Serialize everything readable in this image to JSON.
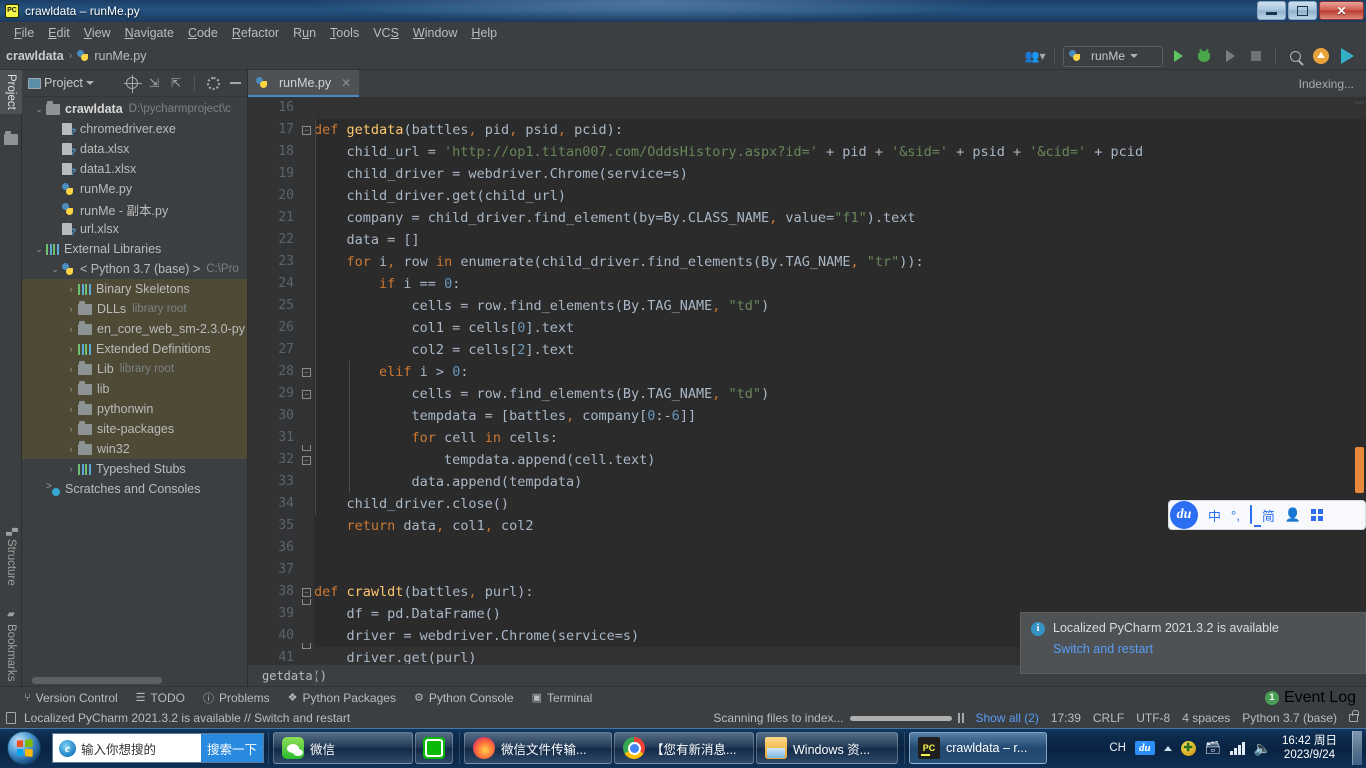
{
  "window": {
    "title": "crawldata – runMe.py",
    "app_icon": "pycharm-icon",
    "controls": {
      "minimize": "minimize-button",
      "restore": "restore-button",
      "close": "✕"
    }
  },
  "menubar": {
    "items": [
      {
        "label": "File"
      },
      {
        "label": "Edit"
      },
      {
        "label": "View"
      },
      {
        "label": "Navigate"
      },
      {
        "label": "Code"
      },
      {
        "label": "Refactor"
      },
      {
        "label": "Run"
      },
      {
        "label": "Tools"
      },
      {
        "label": "VCS"
      },
      {
        "label": "Window"
      },
      {
        "label": "Help"
      }
    ]
  },
  "navbar": {
    "breadcrumbs": [
      "crawldata",
      "runMe.py"
    ],
    "separator": "›",
    "run_config": "runMe",
    "icons": [
      "user-settings-icon",
      "run-icon",
      "debug-icon",
      "run-with-coverage-icon",
      "stop-icon",
      "search-everywhere-icon",
      "update-project-icon",
      "play-alt-icon"
    ]
  },
  "left_tool_strip": {
    "top": [
      {
        "label": "Project",
        "active": true
      }
    ],
    "bottom": [
      {
        "label": "Structure"
      },
      {
        "label": "Bookmarks"
      }
    ]
  },
  "project_panel": {
    "title": "Project",
    "header_icons": [
      "locate-icon",
      "expand-all-icon",
      "collapse-all-icon",
      "gear-icon",
      "hide-icon"
    ],
    "tree": [
      {
        "indent": 0,
        "twist": "v",
        "icon": "folder-icon",
        "label": "crawldata",
        "bold": true,
        "sub": "D:\\pycharmproject\\c",
        "selected": false
      },
      {
        "indent": 1,
        "twist": "",
        "icon": "xlsx-icon",
        "label": "chromedriver.exe",
        "bold": false,
        "sub": "",
        "selected": false
      },
      {
        "indent": 1,
        "twist": "",
        "icon": "xlsx-icon",
        "label": "data.xlsx",
        "bold": false,
        "sub": "",
        "selected": false
      },
      {
        "indent": 1,
        "twist": "",
        "icon": "xlsx-icon",
        "label": "data1.xlsx",
        "bold": false,
        "sub": "",
        "selected": false
      },
      {
        "indent": 1,
        "twist": "",
        "icon": "python-file-icon",
        "label": "runMe.py",
        "bold": false,
        "sub": "",
        "selected": false
      },
      {
        "indent": 1,
        "twist": "",
        "icon": "python-file-icon",
        "label": "runMe - 副本.py",
        "bold": false,
        "sub": "",
        "selected": false
      },
      {
        "indent": 1,
        "twist": "",
        "icon": "xlsx-icon",
        "label": "url.xlsx",
        "bold": false,
        "sub": "",
        "selected": false
      },
      {
        "indent": 0,
        "twist": "v",
        "icon": "libraries-icon",
        "label": "External Libraries",
        "bold": false,
        "sub": "",
        "selected": false
      },
      {
        "indent": 1,
        "twist": "v",
        "icon": "python-sdk-icon",
        "label": "< Python 3.7 (base) >",
        "bold": false,
        "sub": "C:\\Pro",
        "selected": false
      },
      {
        "indent": 2,
        "twist": ">",
        "icon": "libraries-icon",
        "label": "Binary Skeletons",
        "bold": false,
        "sub": "",
        "selected": true
      },
      {
        "indent": 2,
        "twist": ">",
        "icon": "folder-icon",
        "label": "DLLs",
        "bold": false,
        "sub": "library root",
        "selected": true
      },
      {
        "indent": 2,
        "twist": ">",
        "icon": "folder-icon",
        "label": "en_core_web_sm-2.3.0-py",
        "bold": false,
        "sub": "",
        "selected": true
      },
      {
        "indent": 2,
        "twist": ">",
        "icon": "libraries-icon",
        "label": "Extended Definitions",
        "bold": false,
        "sub": "",
        "selected": true
      },
      {
        "indent": 2,
        "twist": ">",
        "icon": "folder-icon",
        "label": "Lib",
        "bold": false,
        "sub": "library root",
        "selected": true
      },
      {
        "indent": 2,
        "twist": ">",
        "icon": "folder-icon",
        "label": "lib",
        "bold": false,
        "sub": "",
        "selected": true
      },
      {
        "indent": 2,
        "twist": ">",
        "icon": "folder-icon",
        "label": "pythonwin",
        "bold": false,
        "sub": "",
        "selected": true
      },
      {
        "indent": 2,
        "twist": ">",
        "icon": "folder-icon",
        "label": "site-packages",
        "bold": false,
        "sub": "",
        "selected": true
      },
      {
        "indent": 2,
        "twist": ">",
        "icon": "folder-icon",
        "label": "win32",
        "bold": false,
        "sub": "",
        "selected": true
      },
      {
        "indent": 2,
        "twist": ">",
        "icon": "libraries-icon",
        "label": "Typeshed Stubs",
        "bold": false,
        "sub": "",
        "selected": false
      },
      {
        "indent": 0,
        "twist": "",
        "icon": "scratches-icon",
        "label": "Scratches and Consoles",
        "bold": false,
        "sub": "",
        "selected": false
      }
    ]
  },
  "editor": {
    "tab": {
      "label": "runMe.py",
      "close": "✕",
      "icon": "python-file-icon"
    },
    "indexing_label": "Indexing...",
    "breadcrumb": "getdata()",
    "first_line_number": 16,
    "lines": [
      {
        "n": 16,
        "text": "",
        "current": true
      },
      {
        "n": 17,
        "text": "def getdata(battles, pid, psid, pcid):",
        "current": false
      },
      {
        "n": 18,
        "text": "    child_url = 'http://op1.titan007.com/OddsHistory.aspx?id=' + pid + '&sid=' + psid + '&cid=' + pcid",
        "current": false
      },
      {
        "n": 19,
        "text": "    child_driver = webdriver.Chrome(service=s)",
        "current": false
      },
      {
        "n": 20,
        "text": "    child_driver.get(child_url)",
        "current": false
      },
      {
        "n": 21,
        "text": "    company = child_driver.find_element(by=By.CLASS_NAME, value=\"f1\").text",
        "current": false
      },
      {
        "n": 22,
        "text": "    data = []",
        "current": false
      },
      {
        "n": 23,
        "text": "    for i, row in enumerate(child_driver.find_elements(By.TAG_NAME, \"tr\")):",
        "current": false
      },
      {
        "n": 24,
        "text": "        if i == 0:",
        "current": false
      },
      {
        "n": 25,
        "text": "            cells = row.find_elements(By.TAG_NAME, \"td\")",
        "current": false
      },
      {
        "n": 26,
        "text": "            col1 = cells[0].text",
        "current": false
      },
      {
        "n": 27,
        "text": "            col2 = cells[2].text",
        "current": false
      },
      {
        "n": 28,
        "text": "        elif i > 0:",
        "current": false
      },
      {
        "n": 29,
        "text": "            cells = row.find_elements(By.TAG_NAME, \"td\")",
        "current": false
      },
      {
        "n": 30,
        "text": "            tempdata = [battles, company[0:-6]]",
        "current": false
      },
      {
        "n": 31,
        "text": "            for cell in cells:",
        "current": false
      },
      {
        "n": 32,
        "text": "                tempdata.append(cell.text)",
        "current": false
      },
      {
        "n": 33,
        "text": "            data.append(tempdata)",
        "current": false
      },
      {
        "n": 34,
        "text": "    child_driver.close()",
        "current": false
      },
      {
        "n": 35,
        "text": "    return data, col1, col2",
        "current": false
      },
      {
        "n": 36,
        "text": "",
        "current": false
      },
      {
        "n": 37,
        "text": "",
        "current": false
      },
      {
        "n": 38,
        "text": "def crawldt(battles, purl):",
        "current": false
      },
      {
        "n": 39,
        "text": "    df = pd.DataFrame()",
        "current": false
      },
      {
        "n": 40,
        "text": "    driver = webdriver.Chrome(service=s)",
        "current": false
      },
      {
        "n": 41,
        "text": "    driver.get(purl)",
        "current": true
      }
    ]
  },
  "notification": {
    "icon": "info-icon",
    "title": "Localized PyCharm 2021.3.2 is available",
    "link": "Switch and restart"
  },
  "ime_bar": {
    "logo": "du",
    "items": [
      "中",
      "°,",
      "screen-icon",
      "简",
      "user-icon",
      "grid-icon"
    ]
  },
  "tool_window_bar": {
    "items": [
      {
        "label": "Version Control",
        "icon": "branch-icon"
      },
      {
        "label": "TODO",
        "icon": "list-icon"
      },
      {
        "label": "Problems",
        "icon": "warning-icon"
      },
      {
        "label": "Python Packages",
        "icon": "packages-icon"
      },
      {
        "label": "Python Console",
        "icon": "python-console-icon"
      },
      {
        "label": "Terminal",
        "icon": "terminal-icon"
      }
    ],
    "event_log": {
      "label": "Event Log",
      "count": "1"
    }
  },
  "status_bar": {
    "message": "Localized PyCharm 2021.3.2 is available // Switch and restart",
    "progress_text": "Scanning files to index...",
    "show_all": "Show all (2)",
    "time": "17:39",
    "line_separator": "CRLF",
    "encoding": "UTF-8",
    "indent": "4 spaces",
    "interpreter": "Python 3.7 (base)",
    "lock_icon": "lock-icon"
  },
  "taskbar": {
    "start": "start-orb",
    "search": {
      "placeholder": "输入你想搜的",
      "button": "搜索一下",
      "icon": "ie-icon"
    },
    "items": [
      {
        "label": "微信",
        "icon": "wechat-icon",
        "active": false,
        "wide": true
      },
      {
        "label": "",
        "icon": "wechat-transfer-icon",
        "active": false,
        "wide": false
      },
      {
        "label": "微信文件传输...",
        "icon": "firefox-icon",
        "active": false,
        "wide": true
      },
      {
        "label": "【您有新消息...",
        "icon": "chrome-icon",
        "active": false,
        "wide": true
      },
      {
        "label": "Windows 资...",
        "icon": "explorer-icon",
        "active": false,
        "wide": true
      },
      {
        "label": "crawldata – r...",
        "icon": "pycharm-icon",
        "active": true,
        "wide": true
      }
    ],
    "tray": {
      "input_lang": "CH",
      "ime": "du",
      "icons": [
        "expand-tray-icon",
        "update-icon",
        "device-icon",
        "network-icon",
        "volume-icon"
      ],
      "clock_time": "16:42 周日",
      "clock_date": "2023/9/24"
    }
  }
}
